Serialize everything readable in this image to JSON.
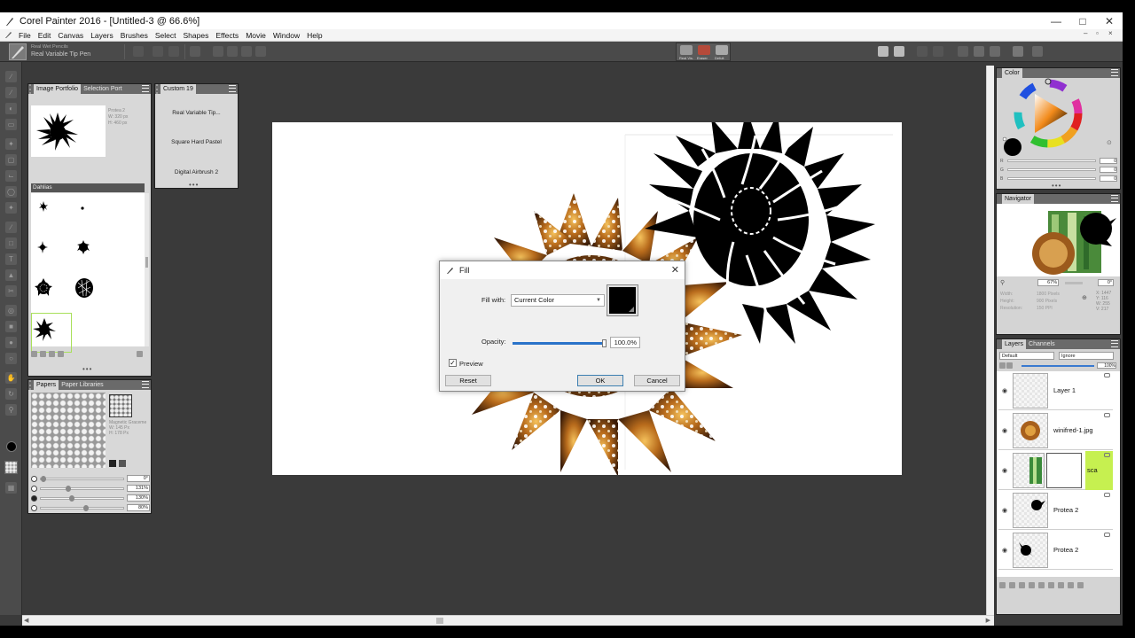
{
  "window": {
    "title": "Corel Painter 2016 - [Untitled-3 @ 66.6%]"
  },
  "menu": [
    "File",
    "Edit",
    "Canvas",
    "Layers",
    "Brushes",
    "Select",
    "Shapes",
    "Effects",
    "Movie",
    "Window",
    "Help"
  ],
  "property_bar": {
    "brush_category": "Real Wet Pencils",
    "brush_variant": "Real Variable Tip Pen",
    "media_tools": [
      "Real Vis.",
      "Eraser",
      "Defult"
    ]
  },
  "image_portfolio": {
    "tabs": [
      "Image Portfolio",
      "Selection Port"
    ],
    "info": [
      "Protea 2",
      "W: 320 px",
      "H: 460 px"
    ],
    "library_name": "Dahlias"
  },
  "custom_palette": {
    "title": "Custom 19",
    "items": [
      "Real Variable Tip...",
      "Square Hard Pastel",
      "Digital Airbrush 2"
    ]
  },
  "papers": {
    "tabs": [
      "Papers",
      "Paper Libraries"
    ],
    "info": [
      "Magnetic Graceme",
      "W: 145 Px",
      "H: 178 Px"
    ],
    "sliders": [
      "0°",
      "131%",
      "130%",
      "80%"
    ]
  },
  "color_panel": {
    "title": "Color",
    "rows": [
      "R",
      "G",
      "B"
    ],
    "values": [
      "0",
      "0",
      "0"
    ]
  },
  "navigator": {
    "title": "Navigator",
    "zoom": "67%",
    "angle": "0°",
    "info_labels": [
      "Width:",
      "Height:",
      "Resolution:"
    ],
    "info_values": [
      "1800 Pixels",
      "900 Pixels",
      "150 PPI"
    ],
    "coords": [
      "X: 1447",
      "Y: 116",
      "W: 255",
      "V: 217"
    ]
  },
  "layers_panel": {
    "tabs": [
      "Layers",
      "Channels"
    ],
    "composite_method": "Default",
    "composite_depth": "Ignore",
    "opacity": "100%",
    "layers": [
      {
        "name": "Layer 1"
      },
      {
        "name": "winifred-1.jpg"
      },
      {
        "name": "sca"
      },
      {
        "name": "Protea 2"
      },
      {
        "name": "Protea 2"
      }
    ]
  },
  "fill_dialog": {
    "title": "Fill",
    "fill_with_label": "Fill with:",
    "fill_with_value": "Current Color",
    "opacity_label": "Opacity:",
    "opacity_value": "100.0%",
    "opacity": 1.0,
    "preview_label": "Preview",
    "preview_checked": "✓",
    "reset": "Reset",
    "ok": "OK",
    "cancel": "Cancel"
  },
  "colors": {
    "accent": "#2a73c9",
    "panel_bg": "#d8d8d8",
    "workspace": "#3a3a3a",
    "selected_layer": "#c6f050"
  }
}
